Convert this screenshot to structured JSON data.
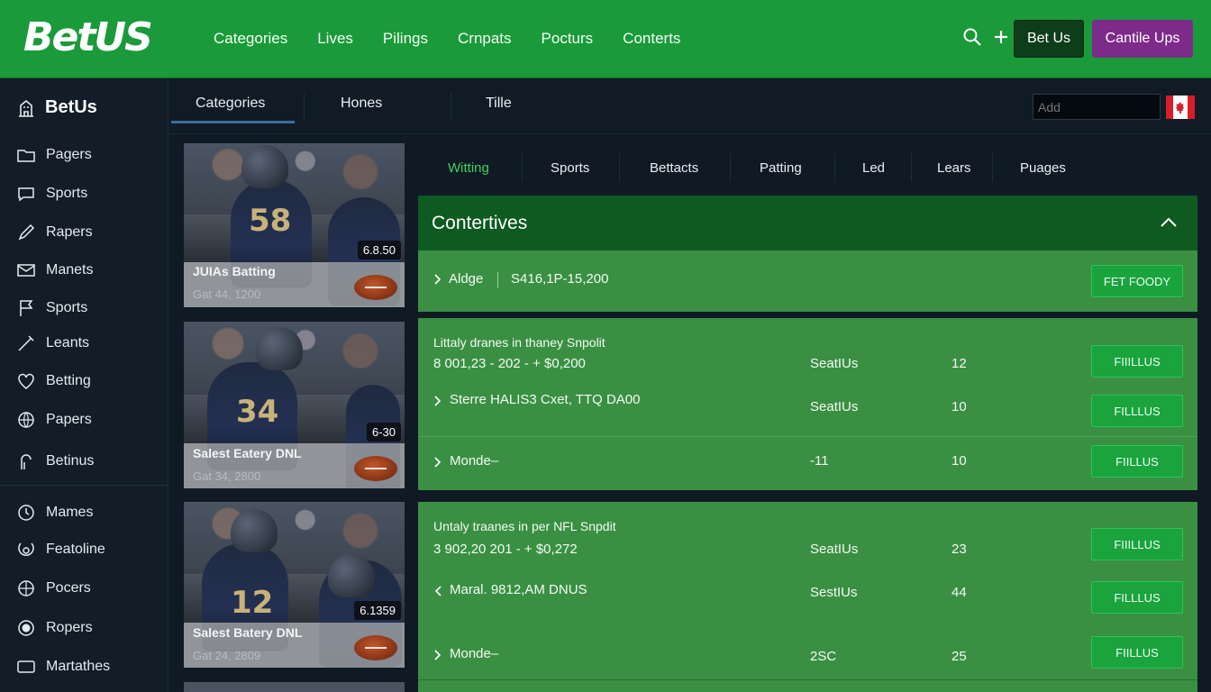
{
  "header": {
    "logo": "BetUS",
    "nav": [
      "Categories",
      "Lives",
      "Pilings",
      "Crnpats",
      "Pocturs",
      "Conterts"
    ],
    "btn_betus": "Bet Us",
    "btn_cantile": "Cantile Ups"
  },
  "sidebar": {
    "brand": "BetUs",
    "items": [
      {
        "label": "Pagers",
        "icon": "folder-icon"
      },
      {
        "label": "Sports",
        "icon": "chat-icon"
      },
      {
        "label": "Rapers",
        "icon": "pen-icon"
      },
      {
        "label": "Manets",
        "icon": "envelope-icon"
      },
      {
        "label": "Sports",
        "icon": "flag-icon"
      },
      {
        "label": "Leants",
        "icon": "wand-icon"
      },
      {
        "label": "Betting",
        "icon": "heart-icon"
      },
      {
        "label": "Papers",
        "icon": "globe-icon"
      },
      {
        "label": "Betinus",
        "icon": "lock-icon"
      },
      {
        "label": "Mames",
        "icon": "clock-icon"
      },
      {
        "label": "Featoline",
        "icon": "target-icon"
      },
      {
        "label": "Pocers",
        "icon": "globe-icon"
      },
      {
        "label": "Ropers",
        "icon": "radio-icon"
      },
      {
        "label": "Martathes",
        "icon": "monitor-icon"
      }
    ]
  },
  "subtabs": [
    "Categories",
    "Hones",
    "Tille"
  ],
  "search": {
    "placeholder": "Add"
  },
  "cards": [
    {
      "title": "JUIAs Batting",
      "sub": "Gat 44, 1200",
      "odds": "6.8.50",
      "number": "58"
    },
    {
      "title": "Salest Eatery DNL",
      "sub": "Gat 34, 2800",
      "odds": "6-30",
      "number": "34"
    },
    {
      "title": "Salest Batery DNL",
      "sub": "Gat 24, 2809",
      "odds": "6.1359",
      "number": "12"
    }
  ],
  "filters": [
    "Witting",
    "Sports",
    "Bettacts",
    "Patting",
    "Led",
    "Lears",
    "Puages"
  ],
  "panel": {
    "title": "Contertives",
    "row1": {
      "name": "Aldge",
      "value": "S416,1P-15,200",
      "button": "FET FOODY"
    }
  },
  "group1": {
    "heading": "Littaly dranes in thaney Snpolit",
    "sub": "8 001,23 - 202 - + $0,200",
    "rows": [
      {
        "name": "",
        "team": "SeatIUs",
        "num": "12",
        "button": "FIIILLUS"
      },
      {
        "name": "Sterre HALIS3 Cxet, TTQ DA00",
        "team": "SeatIUs",
        "num": "10",
        "button": "FILLLUS"
      },
      {
        "name": "Monde–",
        "team": "-11",
        "num": "10",
        "button": "FIILLUS"
      }
    ]
  },
  "group2": {
    "heading": "Untaly traanes in per NFL Snpdit",
    "sub": "3 902,20 201 - + $0,272",
    "rows": [
      {
        "name": "",
        "team": "SeatIUs",
        "num": "23",
        "button": "FIIILLUS"
      },
      {
        "name": "Maral. 9812,AM DNUS",
        "team": "SestIUs",
        "num": "44",
        "button": "FILLLUS"
      },
      {
        "name": "Monde–",
        "team": "2SC",
        "num": "25",
        "button": "FIILLUS"
      }
    ]
  },
  "colors": {
    "brand_green": "#1a9a3a",
    "panel_green": "#3a8f43",
    "accent_purple": "#7e2a8a",
    "active_tab": "#3bd35f"
  }
}
